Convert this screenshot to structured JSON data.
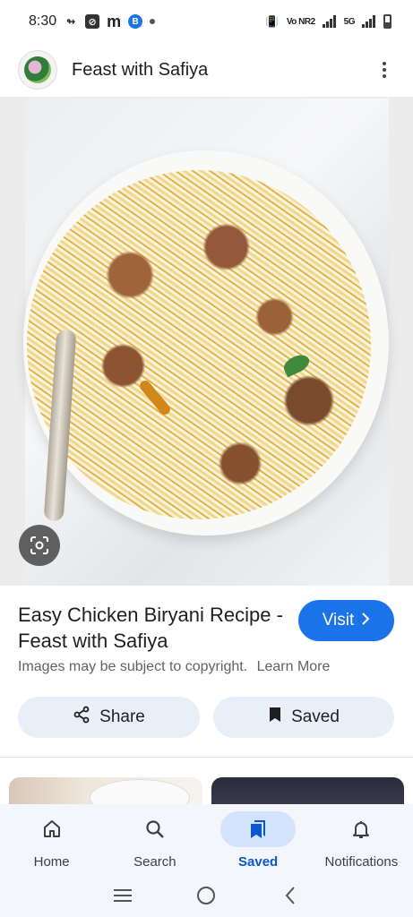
{
  "status_bar": {
    "time": "8:30",
    "network_label": "Vo NR2",
    "network_type": "5G"
  },
  "app_bar": {
    "site_name": "Feast with Safiya",
    "avatar_icon": "site-logo",
    "more_icon": "more-vert-icon"
  },
  "image": {
    "description_icon": "lens-icon"
  },
  "result": {
    "title": "Easy Chicken Biryani Recipe - Feast with Safiya",
    "visit_label": "Visit",
    "copyright_text": "Images may be subject to copyright.",
    "learn_more_label": "Learn More",
    "share_label": "Share",
    "saved_label": "Saved"
  },
  "bottom_nav": {
    "items": [
      {
        "label": "Home",
        "icon": "home-icon"
      },
      {
        "label": "Search",
        "icon": "search-icon"
      },
      {
        "label": "Saved",
        "icon": "bookmarks-icon",
        "active": true
      },
      {
        "label": "Notifications",
        "icon": "bell-icon"
      }
    ]
  },
  "colors": {
    "accent": "#1a73e8",
    "active_nav": "#0b57d0",
    "chip_bg": "#e8eff9"
  }
}
